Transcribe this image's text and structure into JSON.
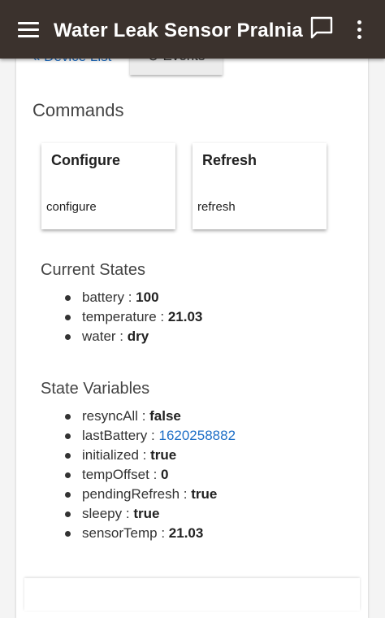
{
  "appbar": {
    "title": "Water Leak Sensor Pralnia"
  },
  "nav": {
    "back_label": "« Device List",
    "events_label": "⊙ Events"
  },
  "commands": {
    "title": "Commands",
    "items": [
      {
        "title": "Configure",
        "label": "configure"
      },
      {
        "title": "Refresh",
        "label": "refresh"
      }
    ]
  },
  "current_states": {
    "title": "Current States",
    "items": [
      {
        "name": "battery",
        "sep": " : ",
        "value": "100"
      },
      {
        "name": "temperature",
        "sep": " : ",
        "value": "21.03"
      },
      {
        "name": "water",
        "sep": " : ",
        "value": "dry"
      }
    ]
  },
  "state_variables": {
    "title": "State Variables",
    "items": [
      {
        "name": "resyncAll",
        "sep": " : ",
        "value": "false"
      },
      {
        "name": "lastBattery",
        "sep": " : ",
        "value": "1620258882"
      },
      {
        "name": "initialized",
        "sep": " : ",
        "value": "true"
      },
      {
        "name": "tempOffset",
        "sep": " : ",
        "value": "0"
      },
      {
        "name": "pendingRefresh",
        "sep": " : ",
        "value": "true"
      },
      {
        "name": "sleepy",
        "sep": " : ",
        "value": "true"
      },
      {
        "name": "sensorTemp",
        "sep": " : ",
        "value": "21.03"
      }
    ]
  },
  "colors": {
    "appbar": "#3b322d",
    "link": "#1e6fc7"
  },
  "icons": {
    "menu": "menu-icon",
    "chat": "chat-icon",
    "more": "more-vert-icon"
  }
}
